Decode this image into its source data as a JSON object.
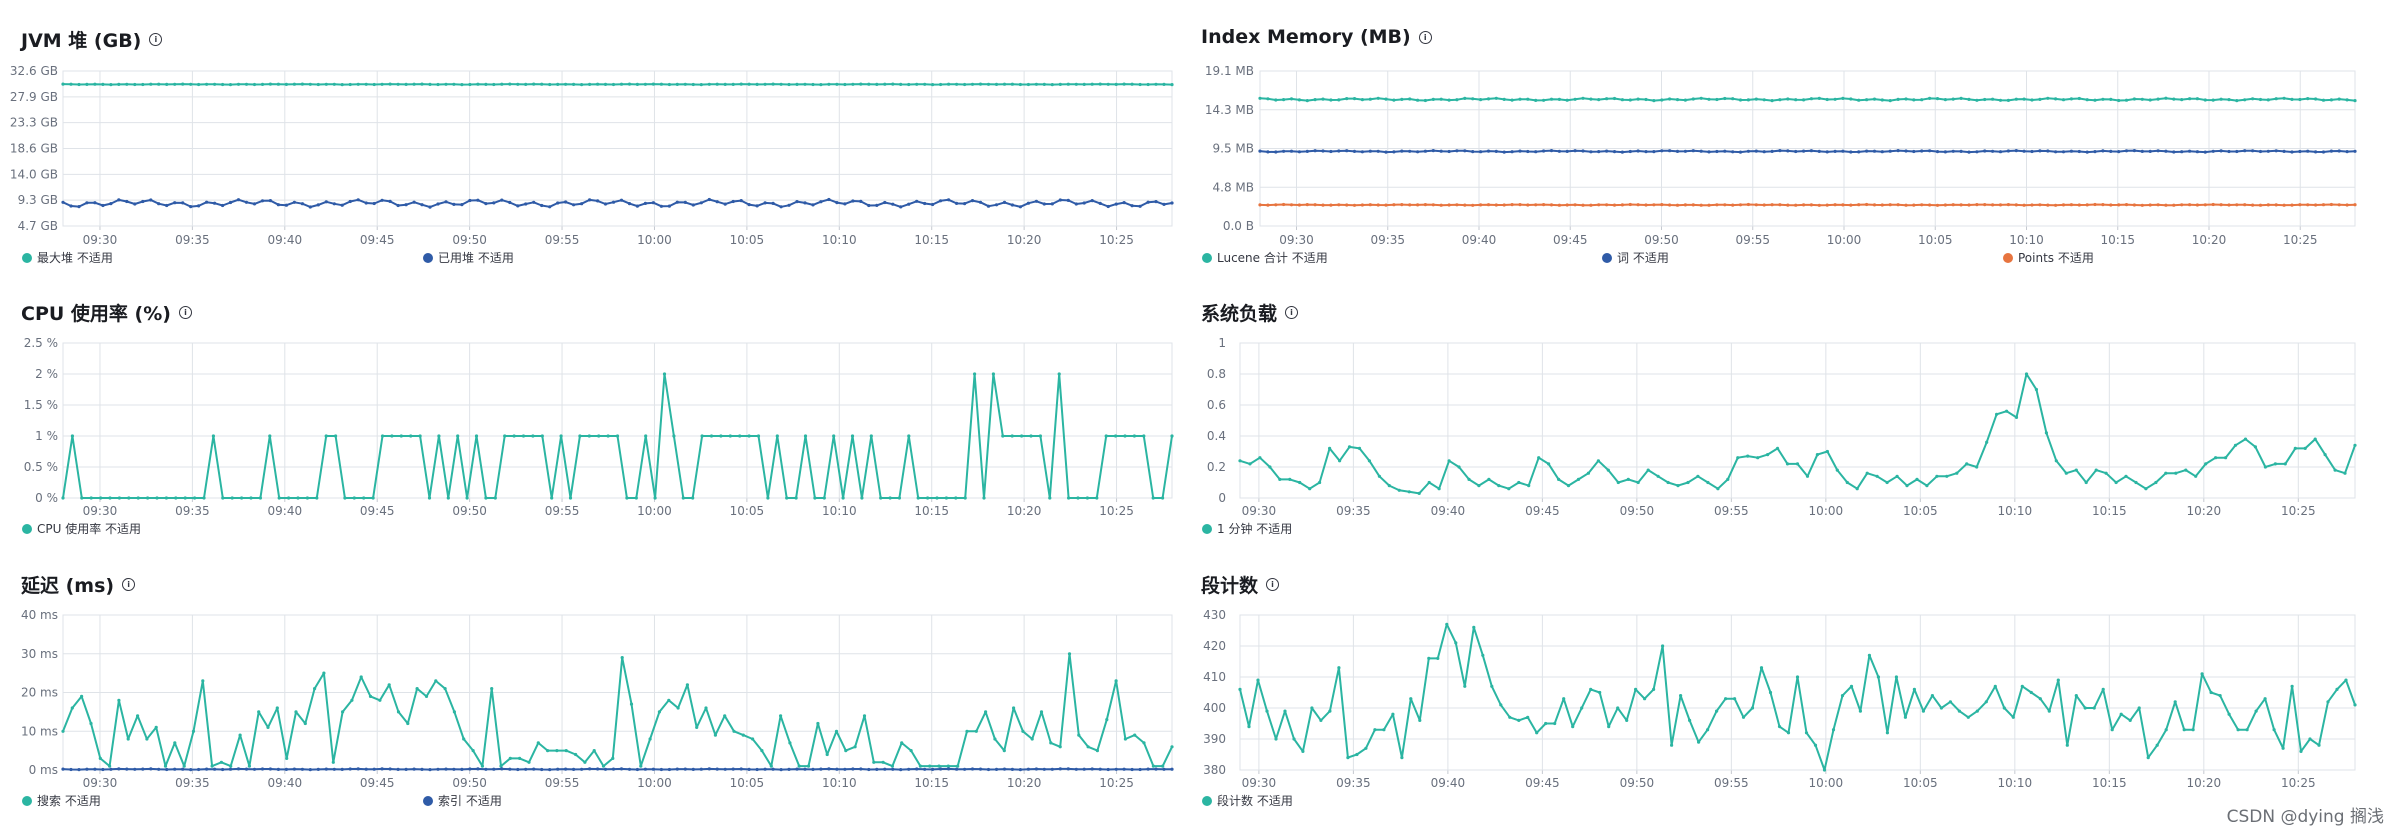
{
  "chart_data": [
    {
      "id": "jvm",
      "type": "line",
      "title": "JVM 堆 (GB)",
      "x": {
        "start": "09:28",
        "end": "10:28",
        "ticks": [
          "09:30",
          "09:35",
          "09:40",
          "09:45",
          "09:50",
          "09:55",
          "10:00",
          "10:05",
          "10:10",
          "10:15",
          "10:20",
          "10:25"
        ]
      },
      "yticks": [
        "32.6 GB",
        "27.9 GB",
        "23.3 GB",
        "18.6 GB",
        "14.0 GB",
        "9.3 GB",
        "4.7 GB"
      ],
      "ylim": [
        4.7,
        32.6
      ],
      "grid": true,
      "series": [
        {
          "name": "最大堆",
          "status": "不适用",
          "color": "#2bb5a2",
          "base": 30.2,
          "amp": 0.05
        },
        {
          "name": "已用堆",
          "status": "不适用",
          "color": "#2f5ba7",
          "base": 8.8,
          "amp": 0.7
        }
      ]
    },
    {
      "id": "index",
      "type": "line",
      "title": "Index Memory (MB)",
      "x": {
        "start": "09:28",
        "end": "10:28",
        "ticks": [
          "09:30",
          "09:35",
          "09:40",
          "09:45",
          "09:50",
          "09:55",
          "10:00",
          "10:05",
          "10:10",
          "10:15",
          "10:20",
          "10:25"
        ]
      },
      "yticks": [
        "19.1 MB",
        "14.3 MB",
        "9.5 MB",
        "4.8 MB",
        "0.0 B"
      ],
      "ylim": [
        0,
        19.1
      ],
      "grid": true,
      "series": [
        {
          "name": "Lucene 合计",
          "status": "不适用",
          "color": "#2bb5a2",
          "base": 15.6,
          "amp": 0.15
        },
        {
          "name": "词",
          "status": "不适用",
          "color": "#2f5ba7",
          "base": 9.2,
          "amp": 0.1
        },
        {
          "name": "Points",
          "status": "不适用",
          "color": "#e7743f",
          "base": 2.6,
          "amp": 0.05
        }
      ]
    },
    {
      "id": "cpu",
      "type": "line",
      "title": "CPU 使用率 (%)",
      "x": {
        "start": "09:28",
        "end": "10:28",
        "ticks": [
          "09:30",
          "09:35",
          "09:40",
          "09:45",
          "09:50",
          "09:55",
          "10:00",
          "10:05",
          "10:10",
          "10:15",
          "10:20",
          "10:25"
        ]
      },
      "yticks": [
        "2.5 %",
        "2 %",
        "1.5 %",
        "1 %",
        "0.5 %",
        "0 %"
      ],
      "ylim": [
        0,
        2.5
      ],
      "grid": true,
      "series": [
        {
          "name": "CPU 使用率",
          "status": "不适用",
          "color": "#2bb5a2",
          "values": [
            0,
            1,
            0,
            0,
            0,
            0,
            0,
            0,
            0,
            0,
            0,
            0,
            0,
            0,
            0,
            0,
            1,
            0,
            0,
            0,
            0,
            0,
            1,
            0,
            0,
            0,
            0,
            0,
            1,
            1,
            0,
            0,
            0,
            0,
            1,
            1,
            1,
            1,
            1,
            0,
            1,
            0,
            1,
            0,
            1,
            0,
            0,
            1,
            1,
            1,
            1,
            1,
            0,
            1,
            0,
            1,
            1,
            1,
            1,
            1,
            0,
            0,
            1,
            0,
            2,
            1,
            0,
            0,
            1,
            1,
            1,
            1,
            1,
            1,
            1,
            0,
            1,
            0,
            0,
            1,
            0,
            0,
            1,
            0,
            1,
            0,
            1,
            0,
            0,
            0,
            1,
            0,
            0,
            0,
            0,
            0,
            0,
            2,
            0,
            2,
            1,
            1,
            1,
            1,
            1,
            0,
            2,
            0,
            0,
            0,
            0,
            1,
            1,
            1,
            1,
            1,
            0,
            0,
            1
          ]
        }
      ]
    },
    {
      "id": "load",
      "type": "line",
      "title": "系统负载",
      "x": {
        "start": "09:29",
        "end": "10:28",
        "ticks": [
          "09:30",
          "09:35",
          "09:40",
          "09:45",
          "09:50",
          "09:55",
          "10:00",
          "10:05",
          "10:10",
          "10:15",
          "10:20",
          "10:25"
        ]
      },
      "yticks": [
        "1",
        "0.8",
        "0.6",
        "0.4",
        "0.2",
        "0"
      ],
      "ylim": [
        0,
        1
      ],
      "grid": true,
      "series": [
        {
          "name": "1 分钟",
          "status": "不适用",
          "color": "#2bb5a2",
          "values": [
            0.24,
            0.22,
            0.26,
            0.2,
            0.12,
            0.12,
            0.1,
            0.06,
            0.1,
            0.32,
            0.24,
            0.33,
            0.32,
            0.24,
            0.14,
            0.08,
            0.05,
            0.04,
            0.03,
            0.1,
            0.06,
            0.24,
            0.2,
            0.12,
            0.08,
            0.12,
            0.08,
            0.06,
            0.1,
            0.08,
            0.26,
            0.22,
            0.12,
            0.08,
            0.12,
            0.16,
            0.24,
            0.18,
            0.1,
            0.12,
            0.1,
            0.18,
            0.14,
            0.1,
            0.08,
            0.1,
            0.14,
            0.1,
            0.06,
            0.12,
            0.26,
            0.27,
            0.26,
            0.28,
            0.32,
            0.22,
            0.22,
            0.14,
            0.28,
            0.3,
            0.18,
            0.1,
            0.06,
            0.16,
            0.14,
            0.1,
            0.14,
            0.08,
            0.12,
            0.08,
            0.14,
            0.14,
            0.16,
            0.22,
            0.2,
            0.36,
            0.54,
            0.56,
            0.52,
            0.8,
            0.7,
            0.42,
            0.24,
            0.16,
            0.18,
            0.1,
            0.18,
            0.16,
            0.1,
            0.14,
            0.1,
            0.06,
            0.1,
            0.16,
            0.16,
            0.18,
            0.14,
            0.22,
            0.26,
            0.26,
            0.34,
            0.38,
            0.33,
            0.2,
            0.22,
            0.22,
            0.32,
            0.32,
            0.38,
            0.28,
            0.18,
            0.16,
            0.34
          ]
        }
      ]
    },
    {
      "id": "latency",
      "type": "line",
      "title": "延迟 (ms)",
      "x": {
        "start": "09:28",
        "end": "10:28",
        "ticks": [
          "09:30",
          "09:35",
          "09:40",
          "09:45",
          "09:50",
          "09:55",
          "10:00",
          "10:05",
          "10:10",
          "10:15",
          "10:20",
          "10:25"
        ]
      },
      "yticks": [
        "40 ms",
        "30 ms",
        "20 ms",
        "10 ms",
        "0 ms"
      ],
      "ylim": [
        0,
        40
      ],
      "grid": true,
      "series": [
        {
          "name": "搜索",
          "status": "不适用",
          "color": "#2bb5a2",
          "values": [
            10,
            16,
            19,
            12,
            3,
            1,
            18,
            8,
            14,
            8,
            11,
            1,
            7,
            1,
            10,
            23,
            1,
            2,
            1,
            9,
            1,
            15,
            11,
            16,
            3,
            15,
            12,
            21,
            25,
            2,
            15,
            18,
            24,
            19,
            18,
            22,
            15,
            12,
            21,
            19,
            23,
            21,
            15,
            8,
            5,
            1,
            21,
            1,
            3,
            3,
            2,
            7,
            5,
            5,
            5,
            4,
            2,
            5,
            1,
            3,
            29,
            17,
            1,
            8,
            15,
            18,
            16,
            22,
            11,
            16,
            9,
            14,
            10,
            9,
            8,
            5,
            1,
            14,
            7,
            1,
            1,
            12,
            4,
            10,
            5,
            6,
            14,
            2,
            2,
            1,
            7,
            5,
            1,
            1,
            1,
            1,
            1,
            10,
            10,
            15,
            8,
            5,
            16,
            10,
            8,
            15,
            7,
            6,
            30,
            9,
            6,
            5,
            13,
            23,
            8,
            9,
            7,
            1,
            1,
            6
          ]
        },
        {
          "name": "索引",
          "status": "不适用",
          "color": "#2f5ba7",
          "base": 0.2,
          "amp": 0.1
        }
      ]
    },
    {
      "id": "segments",
      "type": "line",
      "title": "段计数",
      "x": {
        "start": "09:29",
        "end": "10:28",
        "ticks": [
          "09:30",
          "09:35",
          "09:40",
          "09:45",
          "09:50",
          "09:55",
          "10:00",
          "10:05",
          "10:10",
          "10:15",
          "10:20",
          "10:25"
        ]
      },
      "yticks": [
        "430",
        "420",
        "410",
        "400",
        "390",
        "380"
      ],
      "ylim": [
        380,
        430
      ],
      "grid": true,
      "series": [
        {
          "name": "段计数",
          "status": "不适用",
          "color": "#2bb5a2",
          "values": [
            406,
            394,
            409,
            399,
            390,
            399,
            390,
            386,
            400,
            396,
            399,
            413,
            384,
            385,
            387,
            393,
            393,
            398,
            384,
            403,
            396,
            416,
            416,
            427,
            421,
            407,
            426,
            417,
            407,
            401,
            397,
            396,
            397,
            392,
            395,
            395,
            403,
            394,
            400,
            406,
            405,
            394,
            400,
            396,
            406,
            403,
            406,
            420,
            388,
            404,
            396,
            389,
            393,
            399,
            403,
            403,
            397,
            400,
            413,
            405,
            394,
            392,
            410,
            392,
            388,
            380,
            393,
            404,
            407,
            399,
            417,
            410,
            392,
            410,
            397,
            406,
            399,
            404,
            400,
            402,
            399,
            397,
            399,
            402,
            407,
            400,
            397,
            407,
            405,
            403,
            399,
            409,
            388,
            404,
            400,
            400,
            406,
            393,
            398,
            396,
            400,
            384,
            388,
            393,
            402,
            393,
            393,
            411,
            405,
            404,
            398,
            393,
            393,
            399,
            403,
            393,
            387,
            407,
            386,
            390,
            388,
            402,
            406,
            409,
            401
          ]
        }
      ]
    }
  ],
  "watermark": "CSDN @dying 搁浅"
}
